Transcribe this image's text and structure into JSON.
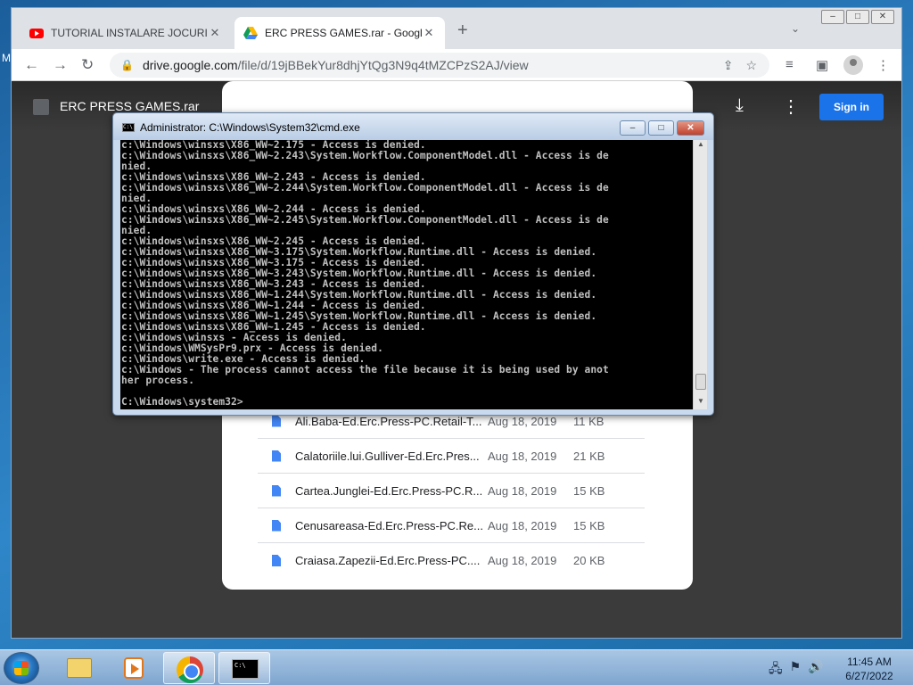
{
  "desktop": {
    "edge_letter": "M"
  },
  "browser": {
    "tabs": [
      {
        "title": "TUTORIAL INSTALARE JOCURI ER",
        "icon": "youtube-icon"
      },
      {
        "title": "ERC PRESS GAMES.rar - Google D",
        "icon": "google-drive-icon"
      }
    ],
    "url_host": "drive.google.com",
    "url_path": "/file/d/19jBBekYur8dhjYtQg3N9q4tMZCPzS2AJ/view",
    "window_buttons": [
      "–",
      "□",
      "✕"
    ]
  },
  "drive": {
    "file_title": "ERC PRESS GAMES.rar",
    "sign_in_label": "Sign in",
    "files": [
      {
        "name": "Ali.Baba-Ed.Erc.Press-PC.Retail-T...",
        "date": "Aug 18, 2019",
        "size": "11 KB"
      },
      {
        "name": "Calatoriile.lui.Gulliver-Ed.Erc.Pres...",
        "date": "Aug 18, 2019",
        "size": "21 KB"
      },
      {
        "name": "Cartea.Junglei-Ed.Erc.Press-PC.R...",
        "date": "Aug 18, 2019",
        "size": "15 KB"
      },
      {
        "name": "Cenusareasa-Ed.Erc.Press-PC.Re...",
        "date": "Aug 18, 2019",
        "size": "15 KB"
      },
      {
        "name": "Craiasa.Zapezii-Ed.Erc.Press-PC....",
        "date": "Aug 18, 2019",
        "size": "20 KB"
      }
    ]
  },
  "cmd": {
    "title": "Administrator: C:\\Windows\\System32\\cmd.exe",
    "icon_text": "C:\\",
    "output": "c:\\Windows\\winsxs\\X86_WW~2.175 - Access is denied.\nc:\\Windows\\winsxs\\X86_WW~2.243\\System.Workflow.ComponentModel.dll - Access is de\nnied.\nc:\\Windows\\winsxs\\X86_WW~2.243 - Access is denied.\nc:\\Windows\\winsxs\\X86_WW~2.244\\System.Workflow.ComponentModel.dll - Access is de\nnied.\nc:\\Windows\\winsxs\\X86_WW~2.244 - Access is denied.\nc:\\Windows\\winsxs\\X86_WW~2.245\\System.Workflow.ComponentModel.dll - Access is de\nnied.\nc:\\Windows\\winsxs\\X86_WW~2.245 - Access is denied.\nc:\\Windows\\winsxs\\X86_WW~3.175\\System.Workflow.Runtime.dll - Access is denied.\nc:\\Windows\\winsxs\\X86_WW~3.175 - Access is denied.\nc:\\Windows\\winsxs\\X86_WW~3.243\\System.Workflow.Runtime.dll - Access is denied.\nc:\\Windows\\winsxs\\X86_WW~3.243 - Access is denied.\nc:\\Windows\\winsxs\\X86_WW~1.244\\System.Workflow.Runtime.dll - Access is denied.\nc:\\Windows\\winsxs\\X86_WW~1.244 - Access is denied.\nc:\\Windows\\winsxs\\X86_WW~1.245\\System.Workflow.Runtime.dll - Access is denied.\nc:\\Windows\\winsxs\\X86_WW~1.245 - Access is denied.\nc:\\Windows\\winsxs - Access is denied.\nc:\\Windows\\WMSysPr9.prx - Access is denied.\nc:\\Windows\\write.exe - Access is denied.\nc:\\Windows - The process cannot access the file because it is being used by anot\nher process.\n\nC:\\Windows\\system32>"
  },
  "taskbar": {
    "clock_time": "11:45 AM",
    "clock_date": "6/27/2022"
  }
}
